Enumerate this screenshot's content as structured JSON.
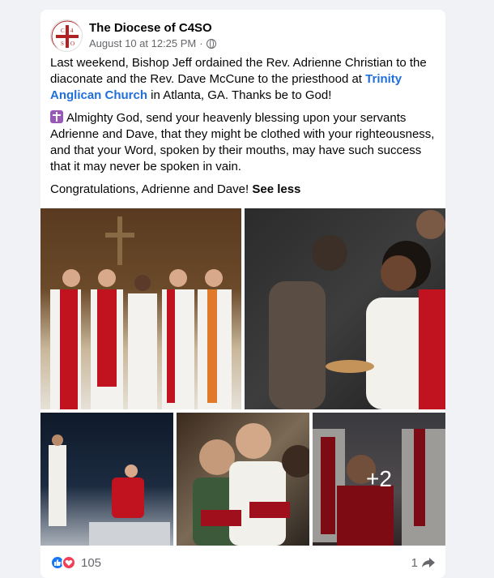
{
  "post": {
    "page_name": "The Diocese of C4SO",
    "timestamp": "August 10 at 12:25 PM",
    "separator": "·",
    "paragraph1_pre": "Last weekend, Bishop Jeff ordained the Rev. Adrienne Christian to the diaconate and the Rev. Dave McCune to the priesthood at ",
    "paragraph1_link": "Trinity Anglican Church",
    "paragraph1_post": " in Atlanta, GA. Thanks be to God!",
    "prayer": "Almighty God, send your heavenly blessing upon your servants Adrienne and Dave, that they might be clothed with your righteousness, and that your Word, spoken by their mouths, may have such success that it may never be spoken in vain.",
    "congrats": "Congratulations, Adrienne and Dave! ",
    "see_less": "See less"
  },
  "photos": {
    "more_count": "+2"
  },
  "footer": {
    "reaction_count": "105",
    "share_count": "1"
  },
  "icons": {
    "like": "like-icon",
    "love": "love-icon",
    "globe": "globe-icon",
    "share": "share-icon",
    "cross": "cross-emoji-icon"
  },
  "colors": {
    "link": "#216fdb",
    "like": "#1877f2",
    "love": "#f33e58",
    "background": "#f0f2f5"
  }
}
